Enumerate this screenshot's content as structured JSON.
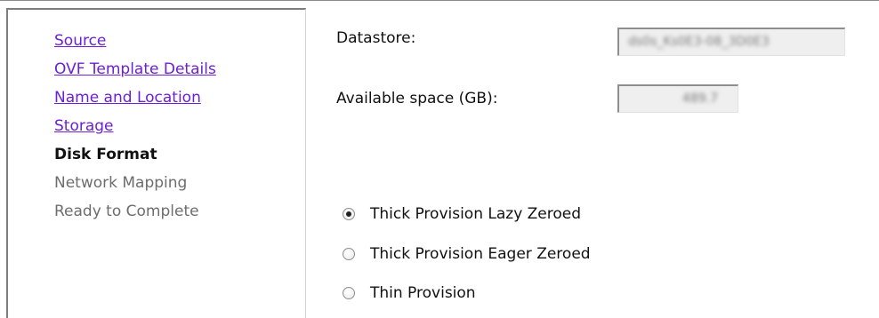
{
  "nav": {
    "items": [
      {
        "label": "Source",
        "state": "link"
      },
      {
        "label": "OVF Template Details",
        "state": "link"
      },
      {
        "label": "Name and Location",
        "state": "link"
      },
      {
        "label": "Storage",
        "state": "link"
      },
      {
        "label": "Disk Format",
        "state": "current"
      },
      {
        "label": "Network Mapping",
        "state": "pending"
      },
      {
        "label": "Ready to Complete",
        "state": "pending"
      }
    ]
  },
  "datastore": {
    "label": "Datastore:",
    "value": "ds0s_Ks0E3-08_3D0E3"
  },
  "available_space": {
    "label": "Available space (GB):",
    "value": "489.7"
  },
  "disk_format": {
    "selected": "Thick Provision Lazy Zeroed",
    "options": [
      {
        "label": "Thick Provision Lazy Zeroed",
        "checked": true
      },
      {
        "label": "Thick Provision Eager Zeroed",
        "checked": false
      },
      {
        "label": "Thin Provision",
        "checked": false
      }
    ]
  },
  "colors": {
    "link": "#6b1fd6",
    "current": "#111111",
    "pending": "#6d6d6d",
    "field_bg": "#efefef"
  }
}
